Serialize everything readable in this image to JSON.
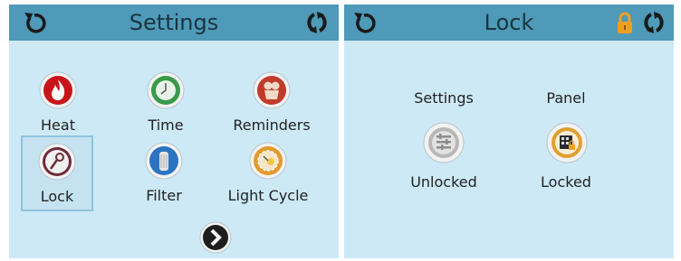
{
  "settings_screen": {
    "title": "Settings",
    "tiles": [
      {
        "label": "Heat",
        "icon": "flame-icon"
      },
      {
        "label": "Time",
        "icon": "clock-icon"
      },
      {
        "label": "Reminders",
        "icon": "reminder-icon"
      },
      {
        "label": "Lock",
        "icon": "key-icon",
        "selected": true
      },
      {
        "label": "Filter",
        "icon": "filter-icon"
      },
      {
        "label": "Light Cycle",
        "icon": "light-cycle-icon"
      }
    ],
    "next_icon": "chevron-right-icon"
  },
  "lock_screen": {
    "title": "Lock",
    "settings": {
      "heading": "Settings",
      "status": "Unlocked",
      "icon": "settings-list-icon"
    },
    "panel": {
      "heading": "Panel",
      "status": "Locked",
      "icon": "panel-keypad-icon"
    },
    "lock_indicator_icon": "padlock-icon"
  },
  "header_icons": {
    "back": "back-arrow-icon",
    "refresh": "refresh-icon"
  },
  "colors": {
    "header": "#4e9ab8",
    "background": "#cde9f6",
    "lock_indicator": "#f0a020"
  }
}
